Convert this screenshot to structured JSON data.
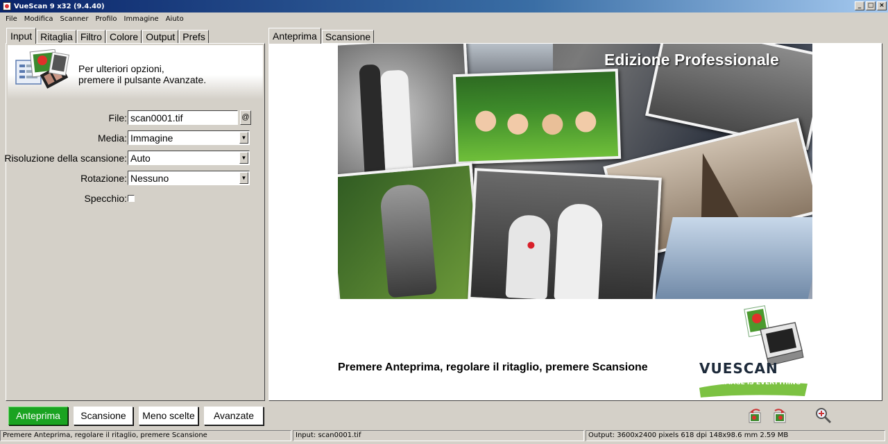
{
  "window": {
    "title": "VueScan 9 x32 (9.4.40)"
  },
  "menu": [
    "File",
    "Modifica",
    "Scanner",
    "Profilo",
    "Immagine",
    "Aiuto"
  ],
  "left_tabs": [
    "Input",
    "Ritaglia",
    "Filtro",
    "Colore",
    "Output",
    "Prefs"
  ],
  "right_tabs": [
    "Anteprima",
    "Scansione"
  ],
  "hint": {
    "line1": "Per ulteriori opzioni,",
    "line2": "premere il pulsante Avanzate."
  },
  "form": {
    "file_label": "File:",
    "file_value": "scan0001.tif",
    "at_button": "@",
    "media_label": "Media:",
    "media_value": "Immagine",
    "resolution_label": "Risoluzione della scansione:",
    "resolution_value": "Auto",
    "rotation_label": "Rotazione:",
    "rotation_value": "Nessuno",
    "mirror_label": "Specchio:",
    "mirror_checked": false
  },
  "buttons": {
    "preview": "Anteprima",
    "scan": "Scansione",
    "fewer": "Meno scelte",
    "advanced": "Avanzate"
  },
  "preview": {
    "edition": "Edizione Professionale",
    "caption": "Premere Anteprima, regolare il ritaglio, premere Scansione",
    "logo_text": "VUESCAN",
    "logo_tagline": "THE IMAGE IS EVERYTHING"
  },
  "status": {
    "left": "Premere Anteprima, regolare il ritaglio, premere Scansione",
    "input": "Input: scan0001.tif",
    "output": "Output: 3600x2400 pixels 618 dpi 148x98.6 mm 2.59 MB"
  },
  "colors": {
    "primary_button": "#1aa321",
    "title_bar": "#0a246a"
  }
}
